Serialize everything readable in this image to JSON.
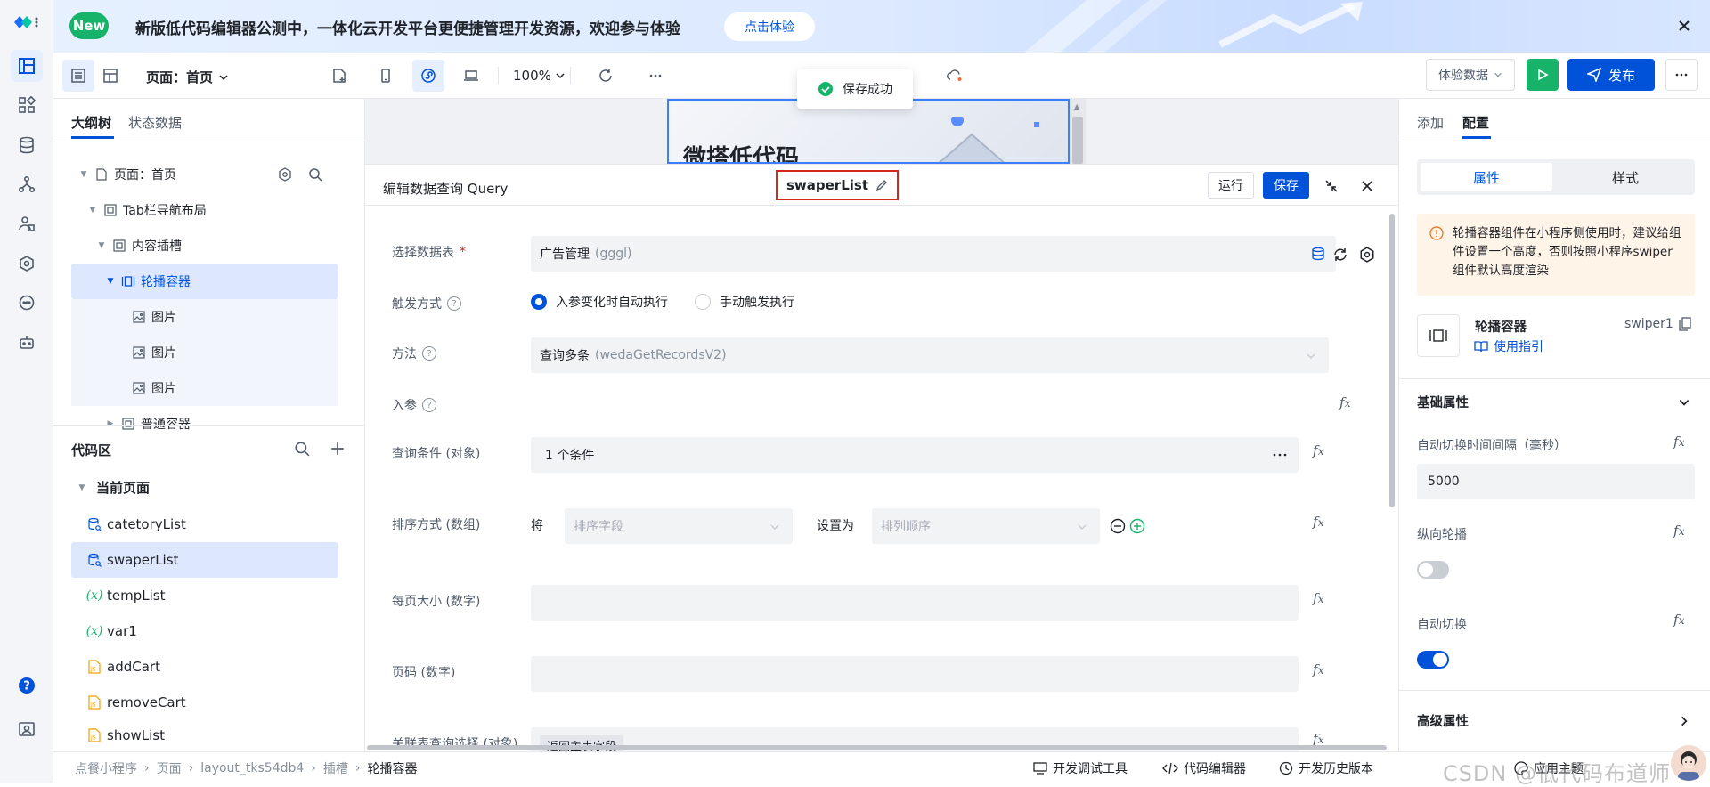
{
  "colors": {
    "primary": "#0052d9",
    "success": "#18b36b",
    "danger": "#d4251f",
    "warn_bg": "#fff4e8"
  },
  "rail": {
    "icons": [
      "logo-icon",
      "layout-icon",
      "components-icon",
      "database-icon",
      "flow-icon",
      "people-icon",
      "shield-icon",
      "chat-icon",
      "robot-icon",
      "help-icon",
      "profile-icon"
    ]
  },
  "banner": {
    "badge": "New",
    "text": "新版低代码编辑器公测中，一体化云开发平台更便捷管理开发资源，欢迎参与体验",
    "cta": "点击体验"
  },
  "toolbar": {
    "page_label": "页面：首页",
    "zoom": "100%",
    "data_select": "体验数据",
    "publish": "发布"
  },
  "toast": {
    "text": "保存成功"
  },
  "left": {
    "tabs": [
      "大纲树",
      "状态数据"
    ],
    "tree": [
      {
        "label": "页面：首页",
        "icon": "page-icon",
        "depth": 0
      },
      {
        "label": "Tab栏导航布局",
        "icon": "box-icon",
        "depth": 1
      },
      {
        "label": "内容插槽",
        "icon": "box-icon",
        "depth": 2
      },
      {
        "label": "轮播容器",
        "icon": "carousel-icon",
        "depth": 3
      },
      {
        "label": "图片",
        "icon": "image-icon",
        "depth": 4
      },
      {
        "label": "图片",
        "icon": "image-icon",
        "depth": 4
      },
      {
        "label": "图片",
        "icon": "image-icon",
        "depth": 4
      },
      {
        "label": "普通容器",
        "icon": "box-icon",
        "depth": 3
      }
    ],
    "code_title": "代码区",
    "current_page": "当前页面",
    "code_items": [
      {
        "label": "catetoryList",
        "icon": "db-query-icon"
      },
      {
        "label": "swaperList",
        "icon": "db-query-icon"
      },
      {
        "label": "tempList",
        "icon": "variable-icon"
      },
      {
        "label": "var1",
        "icon": "variable-icon"
      },
      {
        "label": "addCart",
        "icon": "js-file-icon"
      },
      {
        "label": "removeCart",
        "icon": "js-file-icon"
      },
      {
        "label": "showList",
        "icon": "js-file-icon"
      }
    ]
  },
  "canvas": {
    "phone_title": "微搭低代码"
  },
  "query": {
    "title": "编辑数据查询 Query",
    "name": "swaperList",
    "run": "运行",
    "save": "保存",
    "fields": {
      "table_label": "选择数据表",
      "table_value": "广告管理",
      "table_code": "(gggl)",
      "trigger_label": "触发方式",
      "trigger_opt1": "入参变化时自动执行",
      "trigger_opt2": "手动触发执行",
      "method_label": "方法",
      "method_value": "查询多条",
      "method_code": "(wedaGetRecordsV2)",
      "params_label": "入参",
      "cond_label": "查询条件 (对象)",
      "cond_value": "1 个条件",
      "sort_label": "排序方式 (数组)",
      "sort_prefix": "将",
      "sort_field_ph": "排序字段",
      "sort_set": "设置为",
      "sort_order_ph": "排列顺序",
      "pagesize_label": "每页大小 (数字)",
      "page_label": "页码 (数字)",
      "join_label": "关联表查询选择 (对象)",
      "join_value": "返回主表字段"
    }
  },
  "right": {
    "tabs": [
      "添加",
      "配置"
    ],
    "seg": [
      "属性",
      "样式"
    ],
    "warning": "轮播容器组件在小程序侧使用时，建议给组件设置一个高度，否则按照小程序swiper组件默认高度渲染",
    "component_name": "轮播容器",
    "component_id": "swiper1",
    "guide": "使用指引",
    "basic_title": "基础属性",
    "interval_label": "自动切换时间间隔（毫秒）",
    "interval_value": "5000",
    "vertical_label": "纵向轮播",
    "vertical_on": false,
    "autoplay_label": "自动切换",
    "autoplay_on": true,
    "advanced_title": "高级属性"
  },
  "status": {
    "crumbs": [
      "点餐小程序",
      "页面",
      "layout_tks54db4",
      "插槽",
      "轮播容器"
    ],
    "tools": [
      "开发调试工具",
      "代码编辑器",
      "开发历史版本",
      "应用主题"
    ],
    "watermark": "CSDN @低代码布道师"
  }
}
